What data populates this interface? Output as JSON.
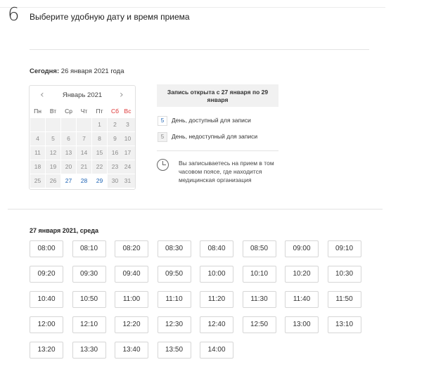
{
  "step": {
    "number": "6",
    "title": "Выберите удобную дату и время приема"
  },
  "today": {
    "label": "Сегодня:",
    "value": "26 января 2021 года"
  },
  "calendar": {
    "month": "Январь 2021",
    "prev_icon": "chevron-left-icon",
    "next_icon": "chevron-right-icon",
    "weekdays": [
      "Пн",
      "Вт",
      "Ср",
      "Чт",
      "Пт",
      "Сб",
      "Вс"
    ],
    "weekend_color": "#dd3333",
    "available_color": "#1e64b4",
    "weeks": [
      [
        [
          "",
          false
        ],
        [
          "",
          false
        ],
        [
          "",
          false
        ],
        [
          "",
          false
        ],
        [
          "1",
          false
        ],
        [
          "2",
          false
        ],
        [
          "3",
          false
        ]
      ],
      [
        [
          "4",
          false
        ],
        [
          "5",
          false
        ],
        [
          "6",
          false
        ],
        [
          "7",
          false
        ],
        [
          "8",
          false
        ],
        [
          "9",
          false
        ],
        [
          "10",
          false
        ]
      ],
      [
        [
          "11",
          false
        ],
        [
          "12",
          false
        ],
        [
          "13",
          false
        ],
        [
          "14",
          false
        ],
        [
          "15",
          false
        ],
        [
          "16",
          false
        ],
        [
          "17",
          false
        ]
      ],
      [
        [
          "18",
          false
        ],
        [
          "19",
          false
        ],
        [
          "20",
          false
        ],
        [
          "21",
          false
        ],
        [
          "22",
          false
        ],
        [
          "23",
          false
        ],
        [
          "24",
          false
        ]
      ],
      [
        [
          "25",
          false
        ],
        [
          "26",
          false
        ],
        [
          "27",
          true
        ],
        [
          "28",
          true
        ],
        [
          "29",
          true
        ],
        [
          "30",
          false
        ],
        [
          "31",
          false
        ]
      ]
    ]
  },
  "info": {
    "open_text": "Запись открыта с 27 января по 29 января",
    "legend_available_sample": "5",
    "legend_available": "День, доступный для записи",
    "legend_unavailable_sample": "5",
    "legend_unavailable": "День, недоступный для записи",
    "timezone_icon": "clock-icon",
    "timezone_note": "Вы записываетесь на прием в том часовом поясе, где находится медицинская организация"
  },
  "slots": {
    "date_label": "27 января 2021, среда",
    "times": [
      "08:00",
      "08:10",
      "08:20",
      "08:30",
      "08:40",
      "08:50",
      "09:00",
      "09:10",
      "09:20",
      "09:30",
      "09:40",
      "09:50",
      "10:00",
      "10:10",
      "10:20",
      "10:30",
      "10:40",
      "10:50",
      "11:00",
      "11:10",
      "11:20",
      "11:30",
      "11:40",
      "11:50",
      "12:00",
      "12:10",
      "12:20",
      "12:30",
      "12:40",
      "12:50",
      "13:00",
      "13:10",
      "13:20",
      "13:30",
      "13:40",
      "13:50",
      "14:00"
    ]
  }
}
